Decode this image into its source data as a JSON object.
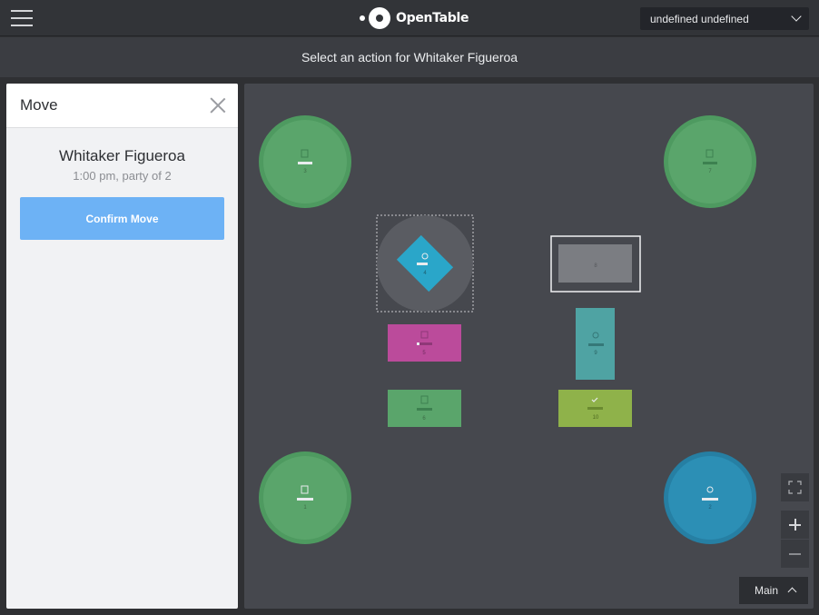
{
  "header": {
    "logo_text": "OpenTable",
    "user_select_value": "undefined undefined"
  },
  "action_bar": {
    "text": "Select an action for Whitaker Figueroa"
  },
  "panel": {
    "title": "Move",
    "guest_name": "Whitaker Figueroa",
    "guest_detail": "1:00 pm, party of 2",
    "confirm_label": "Confirm Move"
  },
  "floor_plan": {
    "tables": [
      {
        "number": "3",
        "status": "seated",
        "color": "#5aa56b",
        "icon": "receipt-icon"
      },
      {
        "number": "7",
        "status": "seated",
        "color": "#5aa56b",
        "icon": "receipt-icon"
      },
      {
        "number": "4",
        "status": "selected",
        "color": "#2aa6c9",
        "icon": "refresh-icon"
      },
      {
        "number": "8",
        "status": "available",
        "color": "#7b7d82",
        "icon": ""
      },
      {
        "number": "5",
        "status": "reserved",
        "color": "#bb4b9b",
        "icon": "glass-icon"
      },
      {
        "number": "9",
        "status": "partially-seated",
        "color": "#4fa3a3",
        "icon": "refresh-icon"
      },
      {
        "number": "6",
        "status": "seated",
        "color": "#5aa56b",
        "icon": "receipt-icon"
      },
      {
        "number": "10",
        "status": "checked",
        "color": "#8fb24a",
        "icon": "check-icon"
      },
      {
        "number": "1",
        "status": "seated",
        "color": "#5aa56b",
        "icon": "receipt-icon"
      },
      {
        "number": "2",
        "status": "partially-seated",
        "color": "#2c8fb5",
        "icon": "refresh-icon"
      }
    ]
  },
  "controls": {
    "room_label": "Main"
  }
}
